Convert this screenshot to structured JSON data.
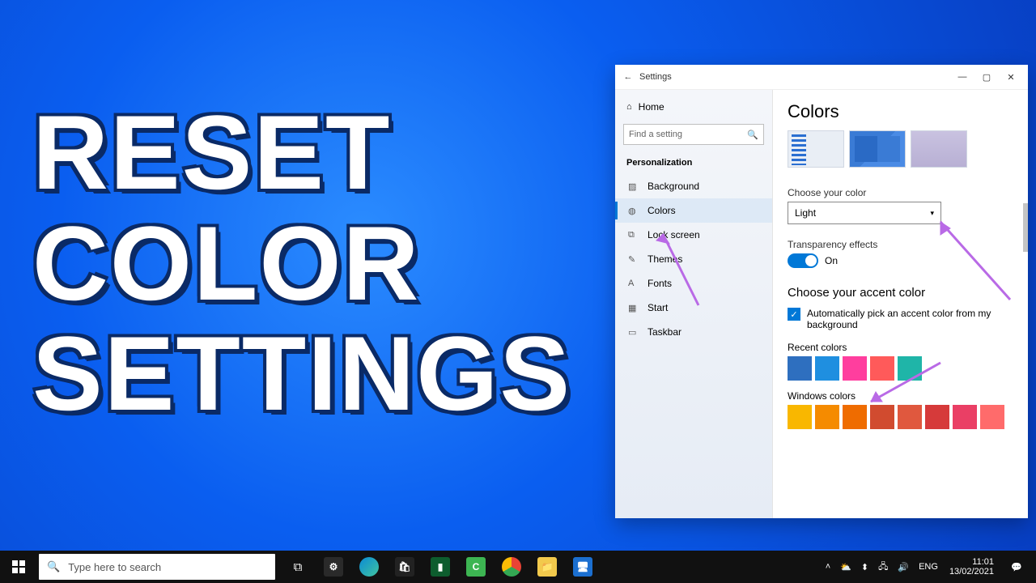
{
  "caption": {
    "line1": "RESET",
    "line2": "COLOR",
    "line3": "SETTINGS"
  },
  "window": {
    "title": "Settings",
    "sidebar": {
      "home": "Home",
      "search_placeholder": "Find a setting",
      "category": "Personalization",
      "items": [
        {
          "label": "Background"
        },
        {
          "label": "Colors",
          "selected": true
        },
        {
          "label": "Lock screen"
        },
        {
          "label": "Themes"
        },
        {
          "label": "Fonts"
        },
        {
          "label": "Start"
        },
        {
          "label": "Taskbar"
        }
      ]
    },
    "content": {
      "heading": "Colors",
      "choose_color_label": "Choose your color",
      "choose_color_value": "Light",
      "transparency_label": "Transparency effects",
      "transparency_state": "On",
      "accent_heading": "Choose your accent color",
      "auto_accent_label": "Automatically pick an accent color from my background",
      "recent_label": "Recent colors",
      "recent_colors": [
        "#2e6fbf",
        "#1f8fe0",
        "#ff3e9e",
        "#ff5a5a",
        "#1fb5a8"
      ],
      "windows_colors_label": "Windows colors",
      "windows_colors_row1": [
        "#f9b700",
        "#f58b00",
        "#ef6c00",
        "#d14b2f",
        "#e0583e",
        "#d63a3a",
        "#ea3f65",
        "#ff6b6b"
      ]
    }
  },
  "taskbar": {
    "search_placeholder": "Type here to search",
    "tray": {
      "lang": "ENG",
      "time": "11:01",
      "date": "13/02/2021"
    }
  }
}
